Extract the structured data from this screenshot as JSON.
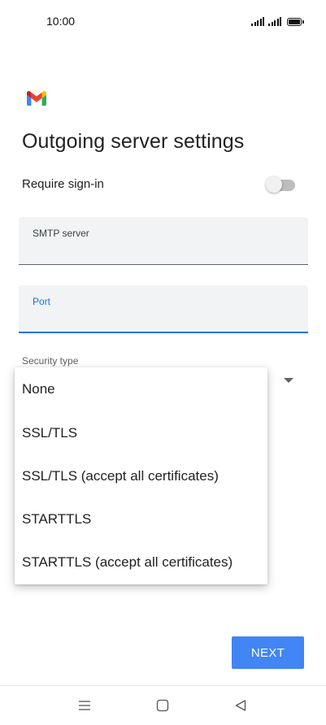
{
  "status_bar": {
    "time": "10:00",
    "icons": [
      "signal-icon",
      "signal-icon",
      "battery-icon"
    ]
  },
  "app": {
    "logo": "gmail-logo",
    "colors": {
      "accent": "#1a73e8",
      "button": "#4285f4",
      "field_bg": "#f1f3f4"
    }
  },
  "page": {
    "title": "Outgoing server settings"
  },
  "signin": {
    "label": "Require sign-in",
    "enabled": false
  },
  "fields": {
    "smtp": {
      "label": "SMTP server",
      "value": ""
    },
    "port": {
      "label": "Port",
      "value": ""
    }
  },
  "security": {
    "label": "Security type",
    "options": [
      "None",
      "SSL/TLS",
      "SSL/TLS (accept all certificates)",
      "STARTTLS",
      "STARTTLS (accept all certificates)"
    ]
  },
  "actions": {
    "next_label": "NEXT"
  },
  "nav_bar": {
    "buttons": [
      "menu-icon",
      "home-icon",
      "back-icon"
    ]
  }
}
